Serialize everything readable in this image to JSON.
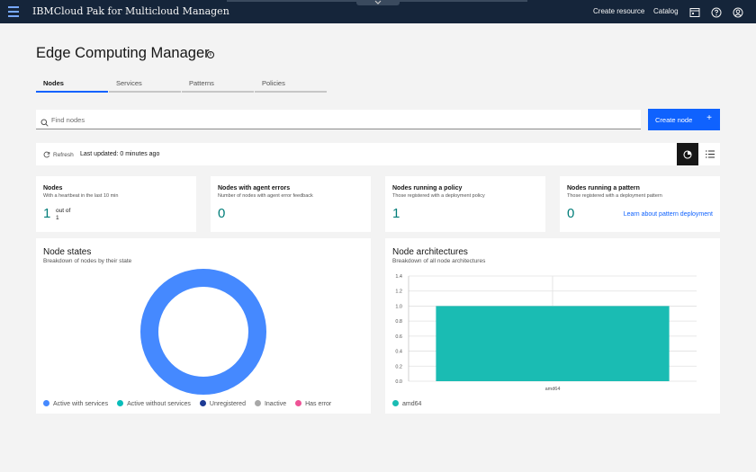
{
  "topbar": {
    "brand": "IBMCloud Pak for Multicloud Managen",
    "create_resource": "Create resource",
    "catalog": "Catalog"
  },
  "page": {
    "title": "Edge Computing Manager",
    "info_glyph": "i"
  },
  "tabs": [
    {
      "label": "Nodes",
      "active": true
    },
    {
      "label": "Services",
      "active": false
    },
    {
      "label": "Patterns",
      "active": false
    },
    {
      "label": "Policies",
      "active": false
    }
  ],
  "search": {
    "placeholder": "Find nodes"
  },
  "create_button": {
    "label": "Create node",
    "icon": "+"
  },
  "toolbar": {
    "refresh_label": "Refresh",
    "last_updated": "Last updated: 0 minutes ago"
  },
  "tiles": [
    {
      "title": "Nodes",
      "subtitle": "With a heartbeat in the last 10 min",
      "value": "1",
      "out_of_label": "out of",
      "out_of_value": "1"
    },
    {
      "title": "Nodes with agent errors",
      "subtitle": "Number of nodes with agent error feedback",
      "value": "0"
    },
    {
      "title": "Nodes running a policy",
      "subtitle": "Those registered with a deployment policy",
      "value": "1"
    },
    {
      "title": "Nodes running a pattern",
      "subtitle": "Those registered with a deployment pattern",
      "value": "0",
      "link": "Learn about pattern deployment"
    }
  ],
  "chart_data": [
    {
      "type": "pie",
      "title": "Node states",
      "subtitle": "Breakdown of nodes by their state",
      "categories": [
        "Active with services",
        "Active without services",
        "Unregistered",
        "Inactive",
        "Has error"
      ],
      "values": [
        1,
        0,
        0,
        0,
        0
      ],
      "colors": [
        "#4589ff",
        "#08bdba",
        "#1c3a94",
        "#a8a8a8",
        "#ee5396"
      ],
      "legend": "bottom-left"
    },
    {
      "type": "bar",
      "title": "Node architectures",
      "subtitle": "Breakdown of all node architectures",
      "categories": [
        "amd64"
      ],
      "values": [
        1.0
      ],
      "ylim": [
        0,
        1.4
      ],
      "yticks": [
        "0.0",
        "0.2",
        "0.4",
        "0.6",
        "0.8",
        "1.0",
        "1.2",
        "1.4"
      ],
      "colors": [
        "#1abcb3"
      ],
      "grid": true,
      "legend": "bottom-left"
    }
  ]
}
